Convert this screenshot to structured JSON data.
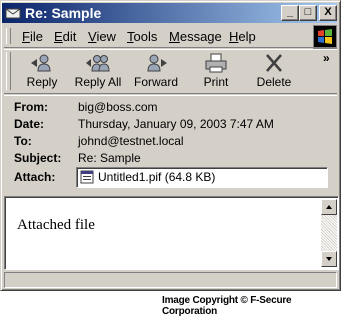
{
  "window": {
    "title": "Re: Sample",
    "buttons": {
      "minimize": "_",
      "maximize": "□",
      "close": "X"
    }
  },
  "menu": [
    {
      "label": "File",
      "mnemonic": "F",
      "rest": "ile"
    },
    {
      "label": "Edit",
      "mnemonic": "E",
      "rest": "dit"
    },
    {
      "label": "View",
      "mnemonic": "V",
      "rest": "iew"
    },
    {
      "label": "Tools",
      "mnemonic": "T",
      "rest": "ools"
    },
    {
      "label": "Message",
      "mnemonic": "M",
      "rest": "essage"
    },
    {
      "label": "Help",
      "mnemonic": "H",
      "rest": "elp"
    }
  ],
  "toolbar": {
    "buttons": [
      {
        "label": "Reply",
        "icon": "reply-icon"
      },
      {
        "label": "Reply All",
        "icon": "reply-all-icon"
      },
      {
        "label": "Forward",
        "icon": "forward-icon"
      },
      {
        "label": "Print",
        "icon": "printer-icon"
      },
      {
        "label": "Delete",
        "icon": "delete-icon"
      }
    ],
    "overflow": "»"
  },
  "headers": {
    "from_label": "From:",
    "from_value": "big@boss.com",
    "date_label": "Date:",
    "date_value": "Thursday, January 09, 2003 7:47 AM",
    "to_label": "To:",
    "to_value": "johnd@testnet.local",
    "subject_label": "Subject:",
    "subject_value": "Re: Sample",
    "attach_label": "Attach:",
    "attach_value": "Untitled1.pif (64.8 KB)"
  },
  "body": {
    "text": "Attached file"
  },
  "footer": {
    "copyright": "Image Copyright © F-Secure Corporation"
  },
  "colors": {
    "titlebar_start": "#0a246a",
    "titlebar_end": "#a6caf0",
    "face": "#d4d0c8"
  }
}
